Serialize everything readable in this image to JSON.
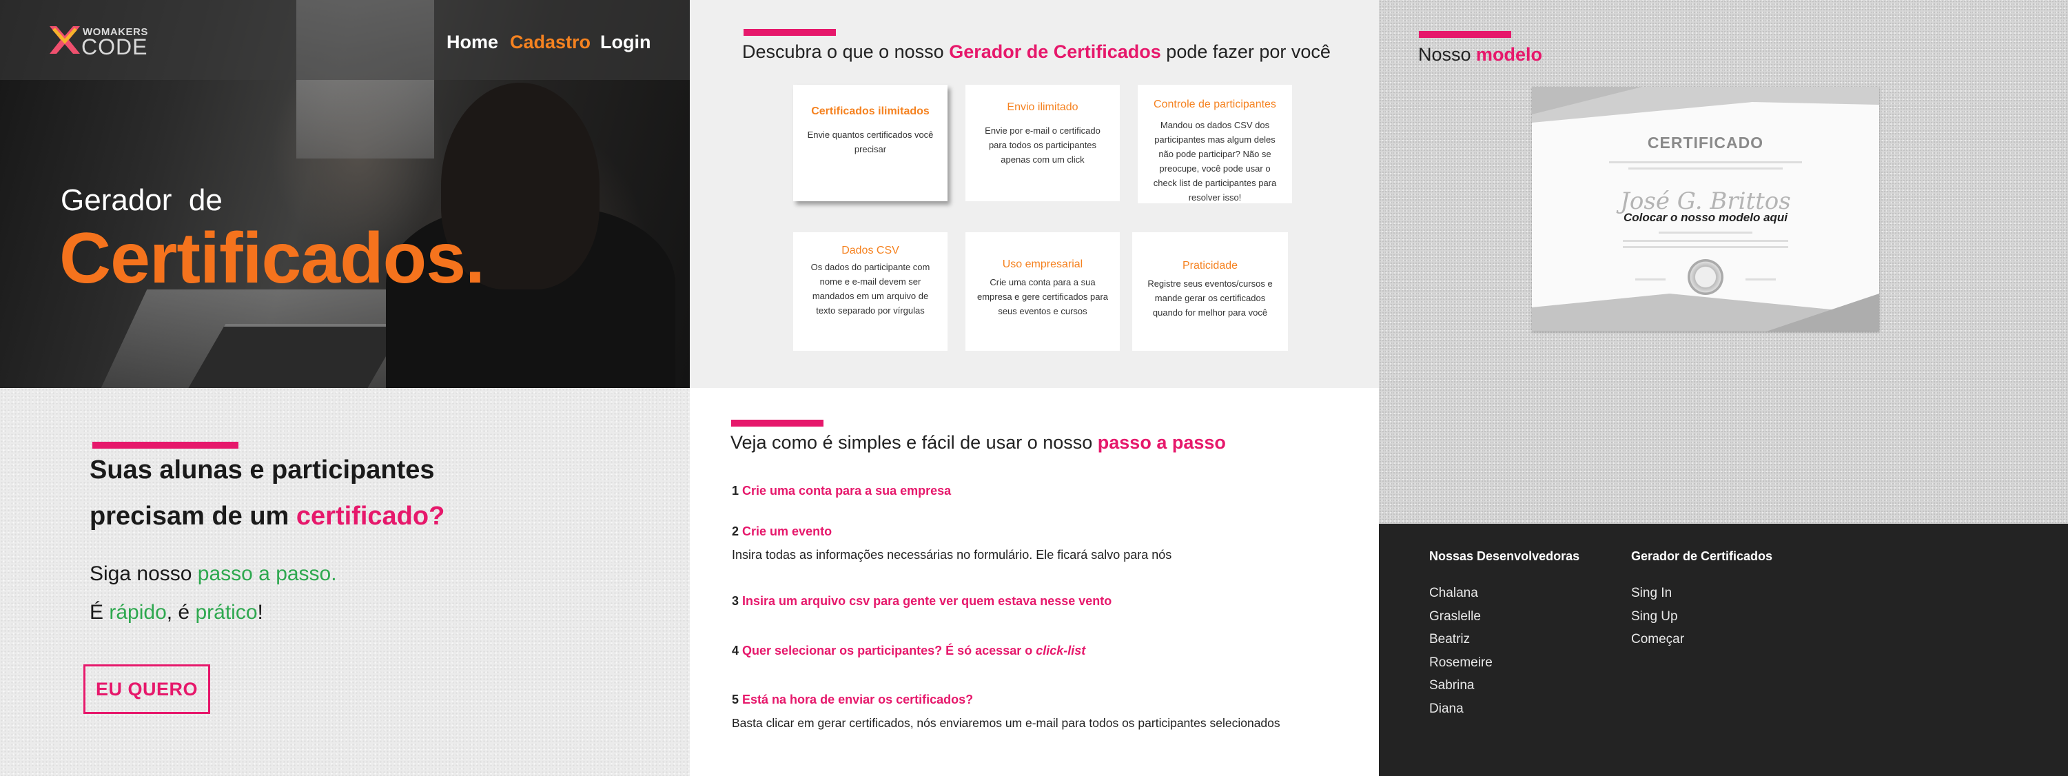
{
  "brand": {
    "logo_small": "WOMAKERS",
    "logo_big": "CODE"
  },
  "nav": {
    "home": "Home",
    "cadastro": "Cadastro",
    "login": "Login"
  },
  "hero": {
    "subtitle": "Gerador  de",
    "title": "Certificados."
  },
  "features": {
    "title_prefix": "Descubra o que o nosso ",
    "title_highlight": "Gerador de Certificados",
    "title_suffix": " pode fazer por você",
    "cards": [
      {
        "title": "Certificados ilimitados",
        "text": "Envie quantos certificados você precisar"
      },
      {
        "title": "Envio ilimitado",
        "text": "Envie por e-mail o certificado para todos os participantes apenas com um click"
      },
      {
        "title": "Controle de participantes",
        "text": "Mandou os dados CSV dos participantes mas algum deles não pode participar? Não se preocupe, você pode usar o check list de participantes para resolver isso!"
      },
      {
        "title": "Dados CSV",
        "text": "Os dados do participante com nome e e-mail devem ser mandados em um arquivo de texto separado por vírgulas"
      },
      {
        "title": "Uso empresarial",
        "text": "Crie uma conta para a sua empresa e gere certificados para seus eventos e cursos"
      },
      {
        "title": "Praticidade",
        "text": "Registre seus eventos/cursos e mande gerar os certificados quando for melhor para você"
      }
    ]
  },
  "modelo": {
    "title_prefix": "Nosso ",
    "title_highlight": "modelo",
    "cert_title": "CERTIFICADO",
    "cert_name": "José G. Brittos",
    "cert_subtitle": "Colocar o nosso modelo aqui"
  },
  "cta_section": {
    "heading_line1": "Suas alunas e participantes",
    "heading_line2_prefix": "precisam de um ",
    "heading_line2_highlight": "certificado?",
    "para1_prefix": "Siga nosso ",
    "para1_highlight": "passo a passo.",
    "para2_a": "É ",
    "para2_b": "rápido",
    "para2_c": ", é ",
    "para2_d": "prático",
    "para2_e": "!",
    "button": "EU QUERO"
  },
  "steps": {
    "title_prefix": "Veja como é simples e fácil de usar o nosso ",
    "title_highlight": "passo a passo",
    "items": [
      {
        "num": "1",
        "title": "Crie uma conta para a sua empresa",
        "desc": ""
      },
      {
        "num": "2",
        "title": "Crie um evento",
        "desc": "Insira todas as informações necessárias no formulário. Ele ficará salvo para nós"
      },
      {
        "num": "3",
        "title": "Insira um arquivo csv para gente ver quem estava nesse vento",
        "desc": ""
      },
      {
        "num": "4",
        "title_a": "Quer selecionar os participantes? É só acessar o ",
        "title_b": "click-list",
        "desc": ""
      },
      {
        "num": "5",
        "title": "Está na hora de enviar os certificados?",
        "desc": "Basta clicar em gerar certificados, nós enviaremos um e-mail para todos os participantes selecionados"
      }
    ]
  },
  "footer": {
    "col1_title": "Nossas Desenvolvedoras",
    "col1_items": [
      "Chalana",
      "Graslelle",
      "Beatriz",
      "Rosemeire",
      "Sabrina",
      "Diana"
    ],
    "col2_title": "Gerador de Certificados",
    "col2_items": [
      "Sing In",
      "Sing Up",
      "Começar"
    ]
  },
  "colors": {
    "pink": "#e6186b",
    "orange": "#f58220",
    "green": "#2ea84f",
    "footer_bg": "#232323"
  }
}
